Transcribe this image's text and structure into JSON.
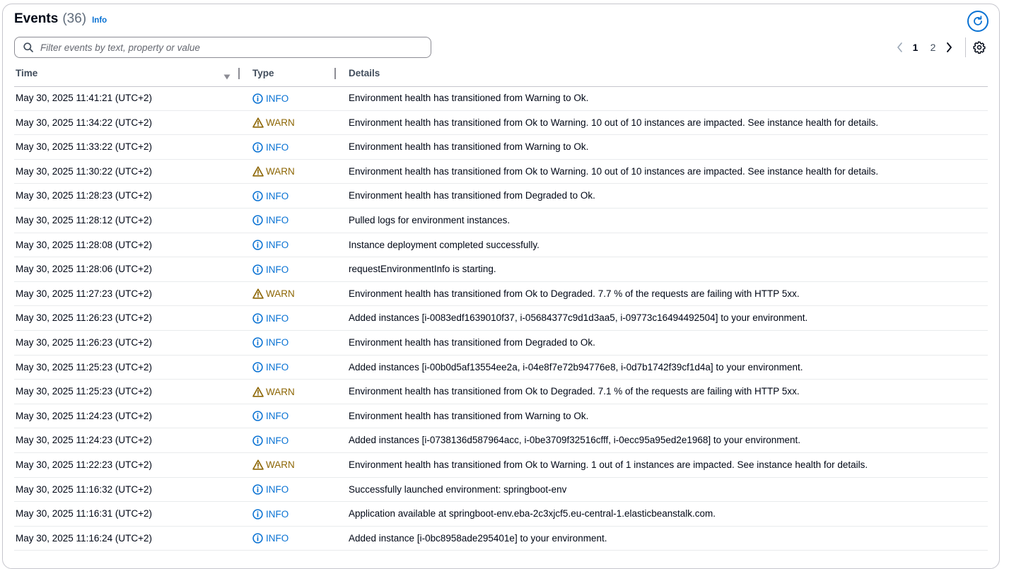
{
  "header": {
    "title": "Events",
    "count": "(36)",
    "info_link": "Info"
  },
  "search": {
    "placeholder": "Filter events by text, property or value",
    "value": ""
  },
  "pagination": {
    "current": "1",
    "pages": [
      "1",
      "2"
    ]
  },
  "icons": {
    "refresh": "refresh-icon",
    "search": "search-icon",
    "settings": "gear-icon",
    "prev": "chevron-left-icon",
    "next": "chevron-right-icon",
    "sort": "sort-descending-icon",
    "info": "info-circle-icon",
    "warn": "warning-triangle-icon"
  },
  "colors": {
    "accent": "#0972d3",
    "warn": "#8d6605",
    "text": "#000716"
  },
  "table": {
    "columns": [
      "Time",
      "Type",
      "Details"
    ],
    "rows": [
      {
        "time": "May 30, 2025 11:41:21 (UTC+2)",
        "type": "INFO",
        "details": "Environment health has transitioned from Warning to Ok."
      },
      {
        "time": "May 30, 2025 11:34:22 (UTC+2)",
        "type": "WARN",
        "details": "Environment health has transitioned from Ok to Warning. 10 out of 10 instances are impacted. See instance health for details."
      },
      {
        "time": "May 30, 2025 11:33:22 (UTC+2)",
        "type": "INFO",
        "details": "Environment health has transitioned from Warning to Ok."
      },
      {
        "time": "May 30, 2025 11:30:22 (UTC+2)",
        "type": "WARN",
        "details": "Environment health has transitioned from Ok to Warning. 10 out of 10 instances are impacted. See instance health for details."
      },
      {
        "time": "May 30, 2025 11:28:23 (UTC+2)",
        "type": "INFO",
        "details": "Environment health has transitioned from Degraded to Ok."
      },
      {
        "time": "May 30, 2025 11:28:12 (UTC+2)",
        "type": "INFO",
        "details": "Pulled logs for environment instances."
      },
      {
        "time": "May 30, 2025 11:28:08 (UTC+2)",
        "type": "INFO",
        "details": "Instance deployment completed successfully."
      },
      {
        "time": "May 30, 2025 11:28:06 (UTC+2)",
        "type": "INFO",
        "details": "requestEnvironmentInfo is starting."
      },
      {
        "time": "May 30, 2025 11:27:23 (UTC+2)",
        "type": "WARN",
        "details": "Environment health has transitioned from Ok to Degraded. 7.7 % of the requests are failing with HTTP 5xx."
      },
      {
        "time": "May 30, 2025 11:26:23 (UTC+2)",
        "type": "INFO",
        "details": "Added instances [i-0083edf1639010f37, i-05684377c9d1d3aa5, i-09773c16494492504] to your environment."
      },
      {
        "time": "May 30, 2025 11:26:23 (UTC+2)",
        "type": "INFO",
        "details": "Environment health has transitioned from Degraded to Ok."
      },
      {
        "time": "May 30, 2025 11:25:23 (UTC+2)",
        "type": "INFO",
        "details": "Added instances [i-00b0d5af13554ee2a, i-04e8f7e72b94776e8, i-0d7b1742f39cf1d4a] to your environment."
      },
      {
        "time": "May 30, 2025 11:25:23 (UTC+2)",
        "type": "WARN",
        "details": "Environment health has transitioned from Ok to Degraded. 7.1 % of the requests are failing with HTTP 5xx."
      },
      {
        "time": "May 30, 2025 11:24:23 (UTC+2)",
        "type": "INFO",
        "details": "Environment health has transitioned from Warning to Ok."
      },
      {
        "time": "May 30, 2025 11:24:23 (UTC+2)",
        "type": "INFO",
        "details": "Added instances [i-0738136d587964acc, i-0be3709f32516cfff, i-0ecc95a95ed2e1968] to your environment."
      },
      {
        "time": "May 30, 2025 11:22:23 (UTC+2)",
        "type": "WARN",
        "details": "Environment health has transitioned from Ok to Warning. 1 out of 1 instances are impacted. See instance health for details."
      },
      {
        "time": "May 30, 2025 11:16:32 (UTC+2)",
        "type": "INFO",
        "details": "Successfully launched environment: springboot-env"
      },
      {
        "time": "May 30, 2025 11:16:31 (UTC+2)",
        "type": "INFO",
        "details": "Application available at springboot-env.eba-2c3xjcf5.eu-central-1.elasticbeanstalk.com."
      },
      {
        "time": "May 30, 2025 11:16:24 (UTC+2)",
        "type": "INFO",
        "details": "Added instance [i-0bc8958ade295401e] to your environment."
      }
    ]
  }
}
